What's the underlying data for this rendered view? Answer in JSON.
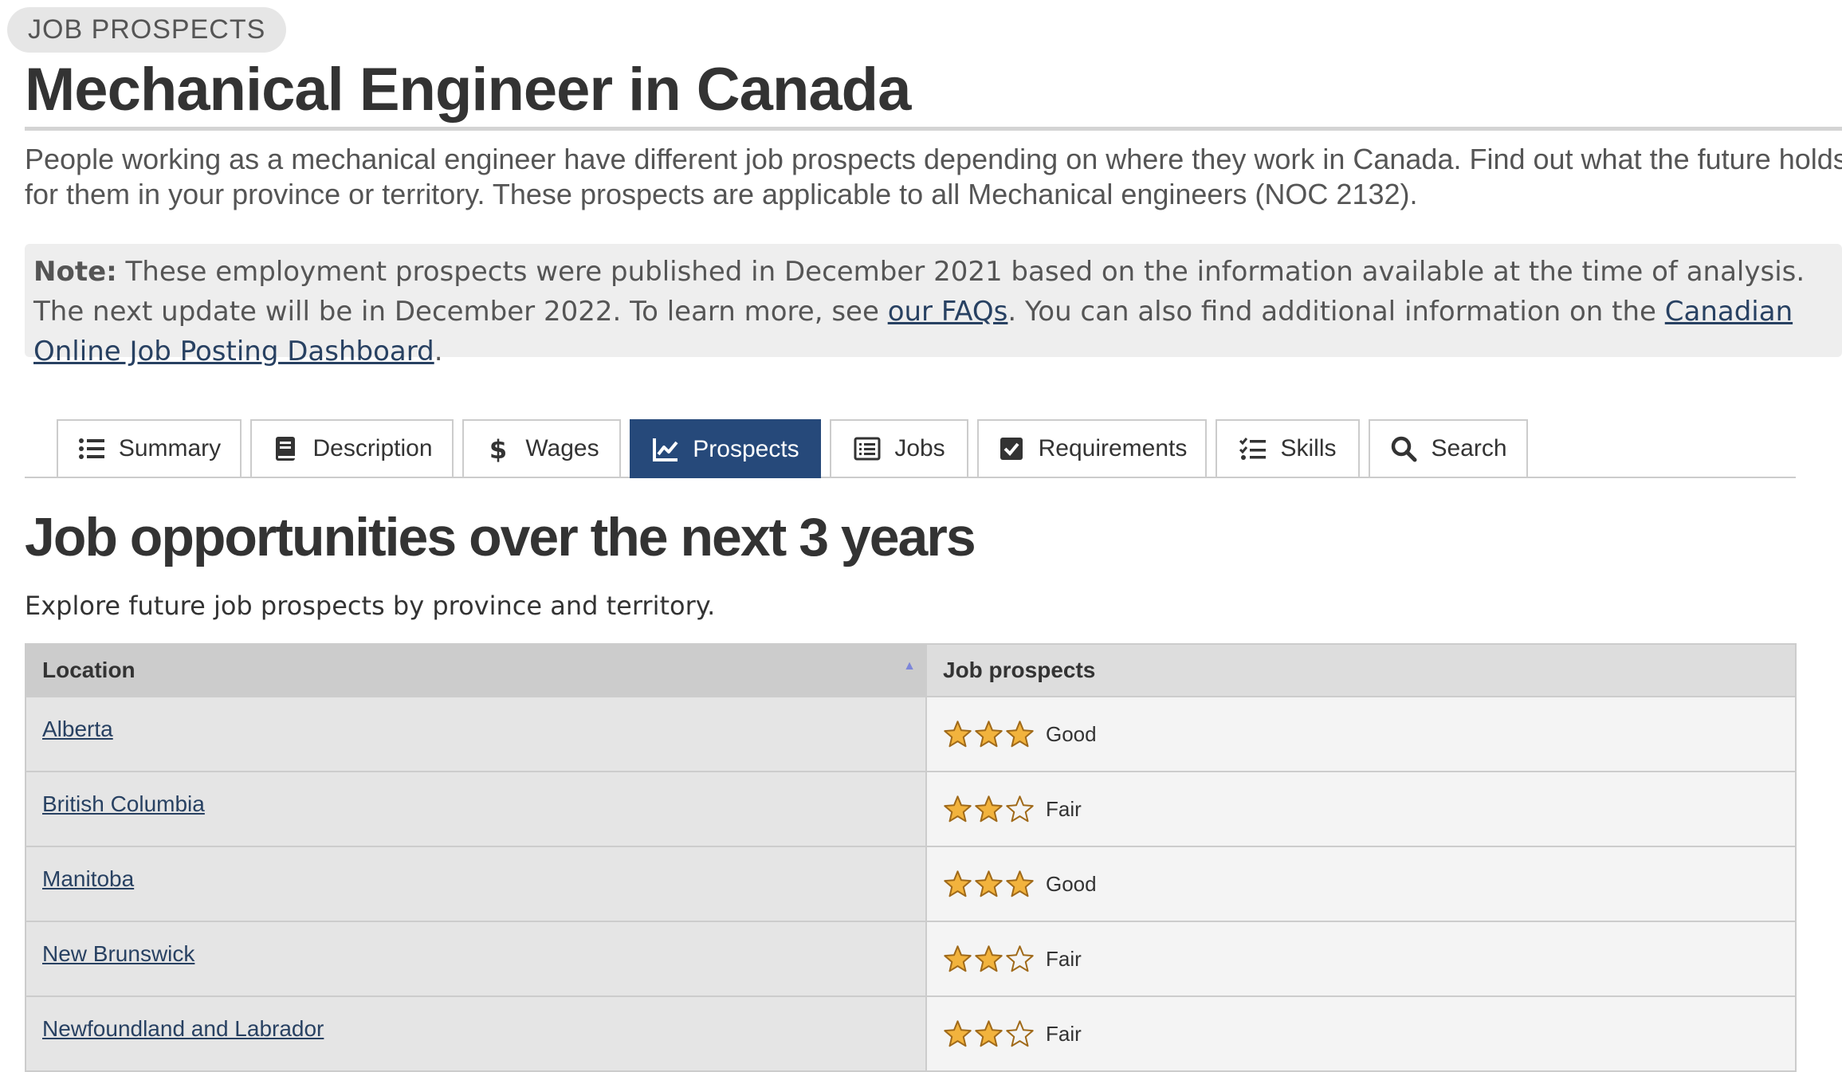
{
  "header": {
    "kicker": "JOB PROSPECTS",
    "title": "Mechanical Engineer in Canada",
    "intro": "People working as a mechanical engineer have different job prospects depending on where they work in Canada. Find out what the future holds for them in your province or territory. These prospects are applicable to all Mechanical engineers (NOC 2132)."
  },
  "note": {
    "label": "Note:",
    "text_before": " These employment prospects were published in December 2021 based on the information available at the time of analysis. The next update will be in December 2022. To learn more, see ",
    "faq_link": "our FAQs",
    "text_middle": ". You can also find additional information on the ",
    "dashboard_link": "Canadian Online Job Posting Dashboard",
    "text_after": "."
  },
  "tabs": [
    {
      "label": "Summary",
      "icon": "list-icon",
      "active": false
    },
    {
      "label": "Description",
      "icon": "book-icon",
      "active": false
    },
    {
      "label": "Wages",
      "icon": "dollar-icon",
      "active": false
    },
    {
      "label": "Prospects",
      "icon": "chart-line-icon",
      "active": true
    },
    {
      "label": "Jobs",
      "icon": "list-alt-icon",
      "active": false
    },
    {
      "label": "Requirements",
      "icon": "check-square-icon",
      "active": false
    },
    {
      "label": "Skills",
      "icon": "tasks-icon",
      "active": false
    },
    {
      "label": "Search",
      "icon": "search-icon",
      "active": false
    }
  ],
  "section": {
    "title": "Job opportunities over the next 3 years",
    "subtitle": "Explore future job prospects by province and territory."
  },
  "table": {
    "headers": {
      "location": "Location",
      "prospects": "Job prospects"
    },
    "rows": [
      {
        "location": "Alberta",
        "stars": 3,
        "rating": "Good"
      },
      {
        "location": "British Columbia",
        "stars": 2,
        "rating": "Fair"
      },
      {
        "location": "Manitoba",
        "stars": 3,
        "rating": "Good"
      },
      {
        "location": "New Brunswick",
        "stars": 2,
        "rating": "Fair"
      },
      {
        "location": "Newfoundland and Labrador",
        "stars": 2,
        "rating": "Fair"
      }
    ],
    "max_stars": 3
  },
  "colors": {
    "accent": "#26497a",
    "link": "#284162",
    "star_fill": "#f2b33d",
    "star_outline": "#a06a1a"
  }
}
